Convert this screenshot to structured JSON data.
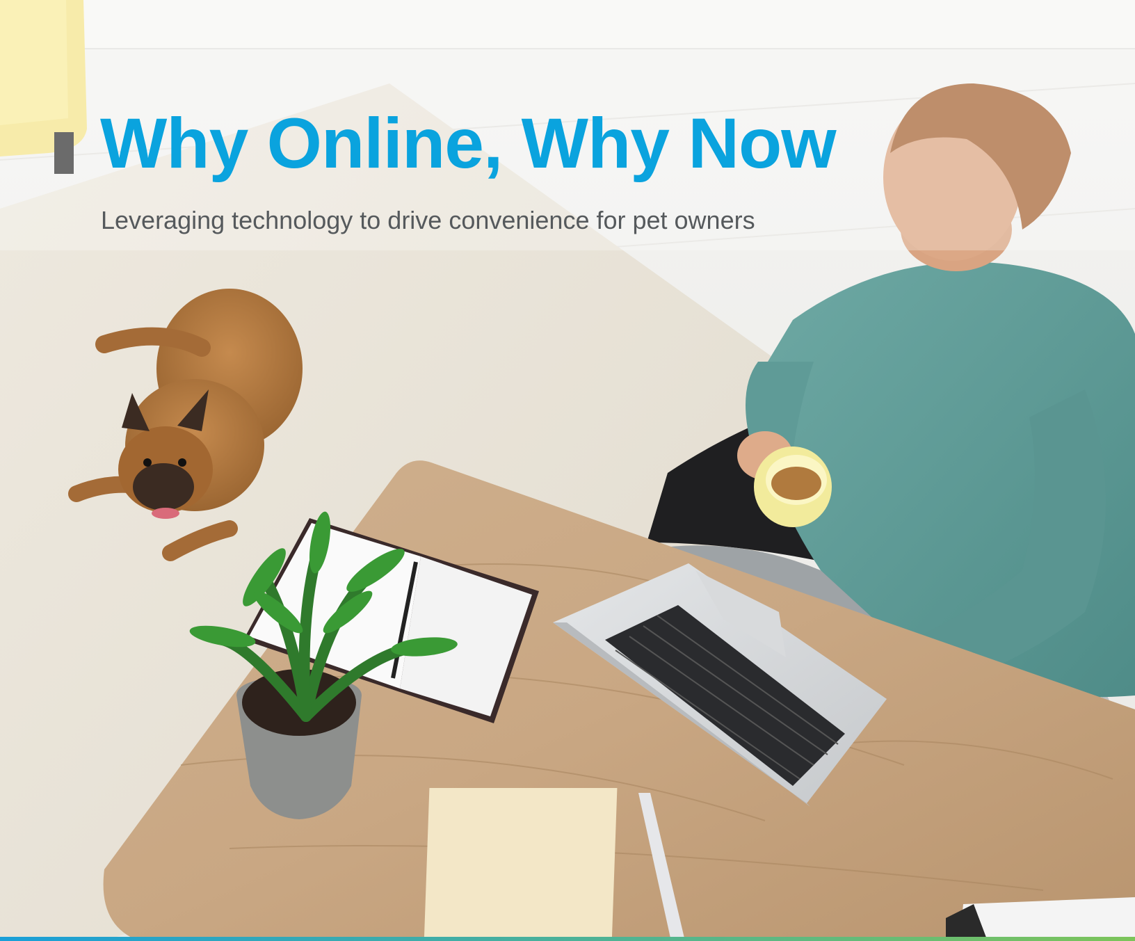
{
  "hero": {
    "title": "Why Online, Why Now",
    "subtitle": "Leveraging technology to drive convenience for pet owners"
  },
  "colors": {
    "title": "#0aa3de",
    "subtitle": "#55595c",
    "accent_start": "#1a9fd8",
    "accent_end": "#7cc45a"
  },
  "photo": {
    "scene": "man-in-wheelchair-at-desk-with-laptop-and-dog"
  }
}
